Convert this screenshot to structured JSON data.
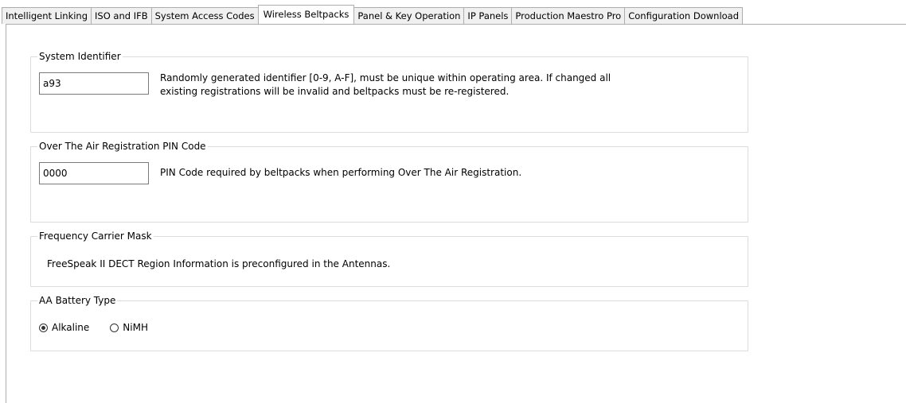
{
  "tabs": [
    {
      "label": "Intelligent Linking",
      "active": false
    },
    {
      "label": "ISO and IFB",
      "active": false
    },
    {
      "label": "System Access Codes",
      "active": false
    },
    {
      "label": "Wireless Beltpacks",
      "active": true
    },
    {
      "label": "Panel & Key Operation",
      "active": false
    },
    {
      "label": "IP Panels",
      "active": false
    },
    {
      "label": "Production Maestro Pro",
      "active": false
    },
    {
      "label": "Configuration Download",
      "active": false
    }
  ],
  "system_identifier": {
    "title": "System Identifier",
    "value": "a93",
    "description_line1": "Randomly generated identifier [0-9, A-F], must be unique within operating area.  If changed all",
    "description_line2": "existing registrations will be invalid and beltpacks must be re-registered."
  },
  "pin_code": {
    "title": "Over The Air Registration PIN Code",
    "value": "0000",
    "description": "PIN Code required by beltpacks when performing Over The Air Registration."
  },
  "frequency_mask": {
    "title": "Frequency Carrier Mask",
    "description": "FreeSpeak II DECT Region Information is preconfigured in the Antennas."
  },
  "battery": {
    "title": "AA Battery Type",
    "options": [
      {
        "label": "Alkaline",
        "selected": true
      },
      {
        "label": "NiMH",
        "selected": false
      }
    ]
  }
}
